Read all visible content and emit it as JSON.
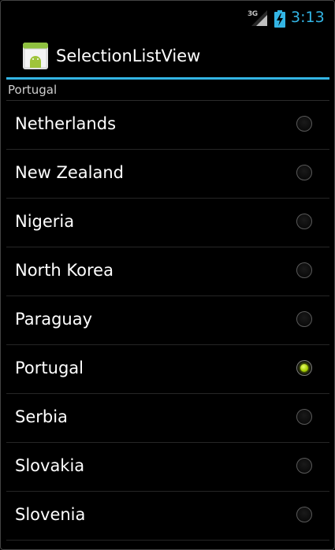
{
  "status_bar": {
    "network": "3G",
    "time": "3:13",
    "clock_color": "#33b5e5"
  },
  "action_bar": {
    "icon": "android-app-icon",
    "title": "SelectionListView",
    "accent_color": "#33b5e5"
  },
  "selection_header": "Portugal",
  "list": {
    "items": [
      {
        "label": "Netherlands",
        "checked": false
      },
      {
        "label": "New Zealand",
        "checked": false
      },
      {
        "label": "Nigeria",
        "checked": false
      },
      {
        "label": "North Korea",
        "checked": false
      },
      {
        "label": "Paraguay",
        "checked": false
      },
      {
        "label": "Portugal",
        "checked": true
      },
      {
        "label": "Serbia",
        "checked": false
      },
      {
        "label": "Slovakia",
        "checked": false
      },
      {
        "label": "Slovenia",
        "checked": false
      }
    ],
    "check_color": "#a4cc00"
  }
}
